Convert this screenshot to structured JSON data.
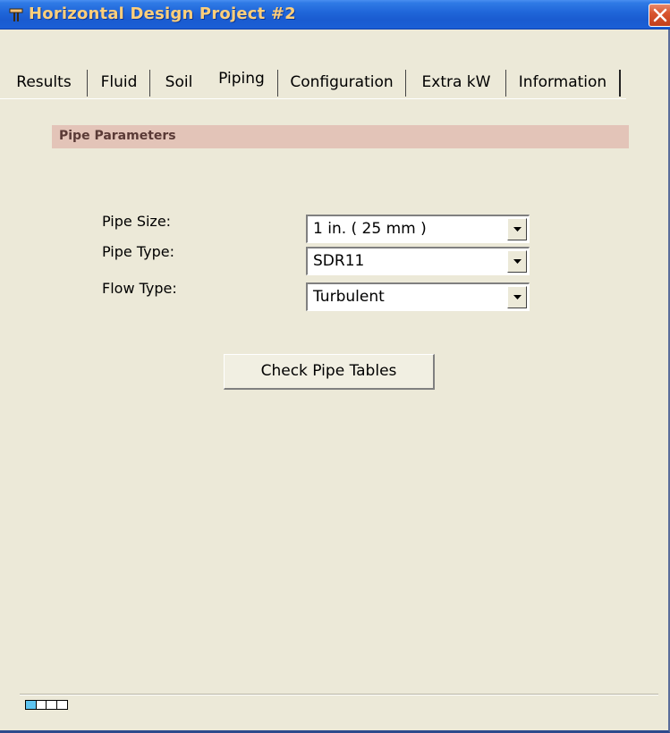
{
  "window": {
    "title": "Horizontal Design Project #2",
    "accent_color": "#1f65d8",
    "title_color": "#ffcf7a",
    "app_icon": "t-shape-icon",
    "close_icon": "close-icon"
  },
  "tabs": [
    {
      "label": "Results",
      "active": false
    },
    {
      "label": "Fluid",
      "active": false
    },
    {
      "label": "Soil",
      "active": false
    },
    {
      "label": "Piping",
      "active": true
    },
    {
      "label": "Configuration",
      "active": false
    },
    {
      "label": "Extra kW",
      "active": false
    },
    {
      "label": "Information",
      "active": false
    }
  ],
  "section": {
    "title": "Pipe Parameters",
    "header_color": "#e3c4b8"
  },
  "fields": {
    "pipe_size": {
      "label": "Pipe Size:",
      "value": "1 in. ( 25 mm )"
    },
    "pipe_type": {
      "label": "Pipe Type:",
      "value": "SDR11"
    },
    "flow_type": {
      "label": "Flow Type:",
      "value": "Turbulent"
    }
  },
  "buttons": {
    "check_pipe_tables": "Check Pipe Tables"
  },
  "status": {
    "progress_segments": 4,
    "progress_filled": 1,
    "progress_fill_color": "#5ec4f0"
  }
}
